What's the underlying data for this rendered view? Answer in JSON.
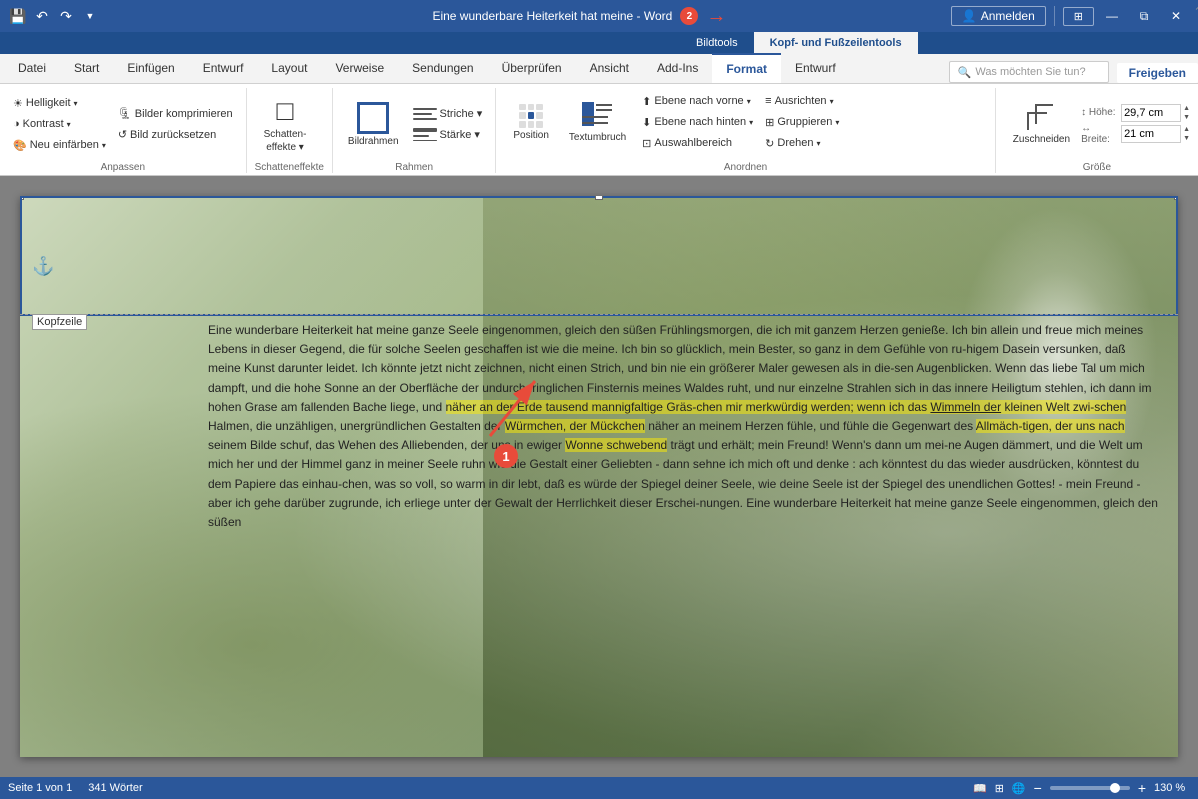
{
  "titleBar": {
    "title": "Eine wunderbare Heiterkeit hat meine - Word",
    "badge": "2",
    "quickAccess": [
      "save",
      "undo",
      "redo",
      "dropdown"
    ]
  },
  "contextTabs": [
    {
      "id": "bildtools",
      "label": "Bildtools",
      "active": false
    },
    {
      "id": "kopf-fusszeilen",
      "label": "Kopf- und Fußzeilentools",
      "active": false
    }
  ],
  "ribbonTabs": [
    {
      "id": "datei",
      "label": "Datei"
    },
    {
      "id": "start",
      "label": "Start"
    },
    {
      "id": "einfuegen",
      "label": "Einfügen"
    },
    {
      "id": "entwurf",
      "label": "Entwurf"
    },
    {
      "id": "layout",
      "label": "Layout"
    },
    {
      "id": "verweise",
      "label": "Verweise"
    },
    {
      "id": "sendungen",
      "label": "Sendungen"
    },
    {
      "id": "ueberpruefen",
      "label": "Überprüfen"
    },
    {
      "id": "ansicht",
      "label": "Ansicht"
    },
    {
      "id": "add-ins",
      "label": "Add-Ins"
    },
    {
      "id": "format",
      "label": "Format",
      "active": true
    },
    {
      "id": "entwurf2",
      "label": "Entwurf"
    }
  ],
  "searchBox": {
    "placeholder": "Was möchten Sie tun?"
  },
  "signIn": {
    "label": "Anmelden",
    "icon": "👤"
  },
  "shareBtn": {
    "label": "Freigeben"
  },
  "ribbonGroups": {
    "anpassen": {
      "label": "Anpassen",
      "buttons": [
        {
          "id": "helligkeit",
          "label": "Helligkeit ▾",
          "icon": "☀"
        },
        {
          "id": "kontrast",
          "label": "Kontrast ▾",
          "icon": "◑"
        },
        {
          "id": "neu-einfuegen",
          "label": "Neu einfärben ▾",
          "icon": "🎨"
        }
      ],
      "rightButtons": [
        {
          "id": "bilder-komprimieren",
          "label": "Bilder komprimieren"
        },
        {
          "id": "bild-zuruecksetzen",
          "label": "Bild zurücksetzen"
        }
      ]
    },
    "schatteneffekte": {
      "label": "Schatteneffekte",
      "button": {
        "id": "schatteneffekte",
        "label": "Schatten-\neffekte ▾",
        "icon": "□"
      }
    },
    "rahmen": {
      "label": "Rahmen",
      "bildrahmen": "Bildrahmen",
      "striche": "Striche ▾",
      "staerke": "Stärke ▾"
    },
    "anordnen": {
      "label": "Anordnen",
      "buttons": [
        {
          "id": "ebene-vorne",
          "label": "Ebene nach vorne ▾"
        },
        {
          "id": "ebene-hinten",
          "label": "Ebene nach hinten ▾"
        },
        {
          "id": "auswahlbereich",
          "label": "Auswahlbereich"
        },
        {
          "id": "ausrichten",
          "label": "Ausrichten ▾"
        },
        {
          "id": "gruppieren",
          "label": "Gruppieren ▾"
        },
        {
          "id": "drehen",
          "label": "Drehen ▾"
        }
      ],
      "position": "Position",
      "textumbruch": "Textumbruch"
    },
    "groesse": {
      "label": "Größe",
      "hoehe": {
        "label": "Höhe:",
        "value": "29,7 cm"
      },
      "breite": {
        "label": "Breite:",
        "value": "21 cm"
      },
      "zuschneiden": "Zuschneiden"
    }
  },
  "document": {
    "kopfzeile": "Kopfzeile",
    "anchorIcon": "⚓",
    "bodyText": "Eine wunderbare Heiterkeit hat meine ganze Seele eingenommen, gleich den süßen Frühlingsmorgen, die ich mit ganzem Herzen genieße. Ich bin allein und freue mich meines Lebens in dieser Gegend, die für solche Seelen geschaffen ist wie die meine. Ich bin so glücklich, mein Bester, so ganz in dem Gefühle von ru-higem Dasein versunken, daß meine Kunst darunter leidet. Ich könnte jetzt nicht zeichnen, nicht einen Strich, und bin nie ein größerer Maler gewesen als in die-sen Augenblicken. Wenn das liebe Tal um mich dampft, und die hohe Sonne an der Oberfläche der undurchdringlichen Finsternis meines Waldes ruht, und nur einzelne Strahlen sich in das innere Heiligtum stehlen, ich dann im hohen Grase am fallenden Bache liege, und näher an der Erde tausend mannigfaltige Gräs-chen mir merkwürdig werden; wenn ich das Wimmeln der kleinen Welt zwi-schen Halmen, die unzähligen, unergründlichen Gestalten der Würmchen, der Mückchen näher an meinem Herzen fühle, und fühle die Gegenwart des Allmäch-tigen, der uns nach seinem Bilde schuf, das Wehen des Alliebenden, der uns in ewiger Wonne schwebend trägt und erhält; mein Freund! Wenn's dann um mei-ne Augen dämmert, und die Welt um mich her und der Himmel ganz in meiner Seele ruhn wie die Gestalt einer Geliebten - dann sehne ich mich oft und denke : ach könntest du das wieder ausdrücken, könntest du dem Papiere das einhau-chen, was so voll, so warm in dir lebt, daß es würde der Spiegel deiner Seele, wie deine Seele ist der Spiegel des unendlichen Gottes! - mein Freund - aber ich gehe darüber zugrunde, ich erliege unter der Gewalt der Herrlichkeit dieser Erschei-nungen. Eine wunderbare Heiterkeit hat meine ganze Seele eingenommen, gleich den süßen",
    "annotation1": "1",
    "annotation2": "2"
  },
  "statusBar": {
    "page": "Seite 1 von 1",
    "words": "341 Wörter",
    "zoom": "130 %",
    "zoomPercent": 75
  },
  "winControls": {
    "minimize": "—",
    "restore": "⧉",
    "close": "✕"
  }
}
